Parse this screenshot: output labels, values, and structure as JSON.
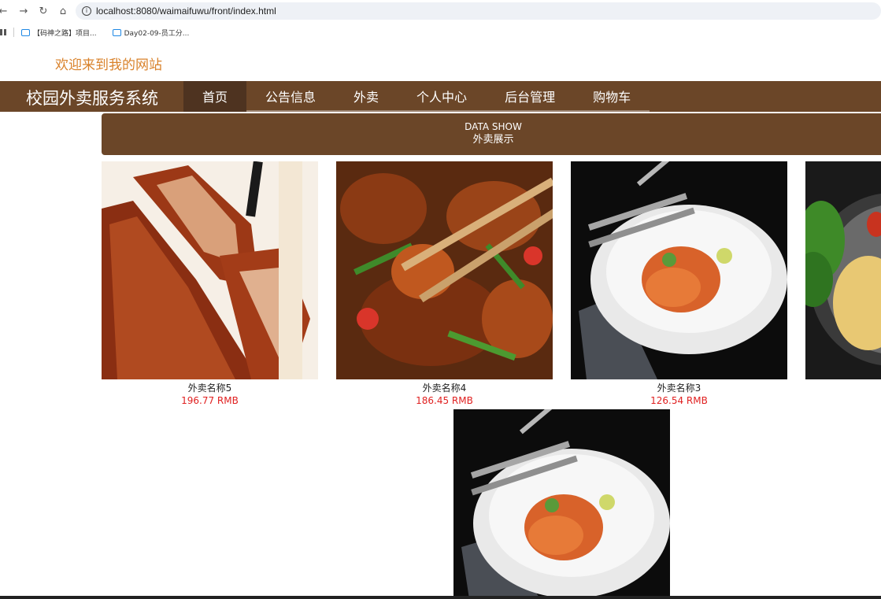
{
  "browser": {
    "url": "localhost:8080/waimaifuwu/front/index.html",
    "bookmarks": [
      {
        "label": "【码神之路】项目..."
      },
      {
        "label": "Day02-09-员工分..."
      }
    ]
  },
  "header": {
    "welcome": "欢迎来到我的网站",
    "brand": "校园外卖服务系统"
  },
  "nav": {
    "items": [
      {
        "label": "首页"
      },
      {
        "label": "公告信息"
      },
      {
        "label": "外卖"
      },
      {
        "label": "个人中心"
      },
      {
        "label": "后台管理"
      },
      {
        "label": "购物车"
      }
    ]
  },
  "section": {
    "title_en": "DATA SHOW",
    "title_cn": "外卖展示"
  },
  "products": [
    {
      "name": "外卖名称5",
      "price": "196.77 RMB"
    },
    {
      "name": "外卖名称4",
      "price": "186.45 RMB"
    },
    {
      "name": "外卖名称3",
      "price": "126.54 RMB"
    }
  ],
  "colors": {
    "nav_bg": "#6b4628",
    "welcome": "#d9822b",
    "price": "#e02020"
  }
}
